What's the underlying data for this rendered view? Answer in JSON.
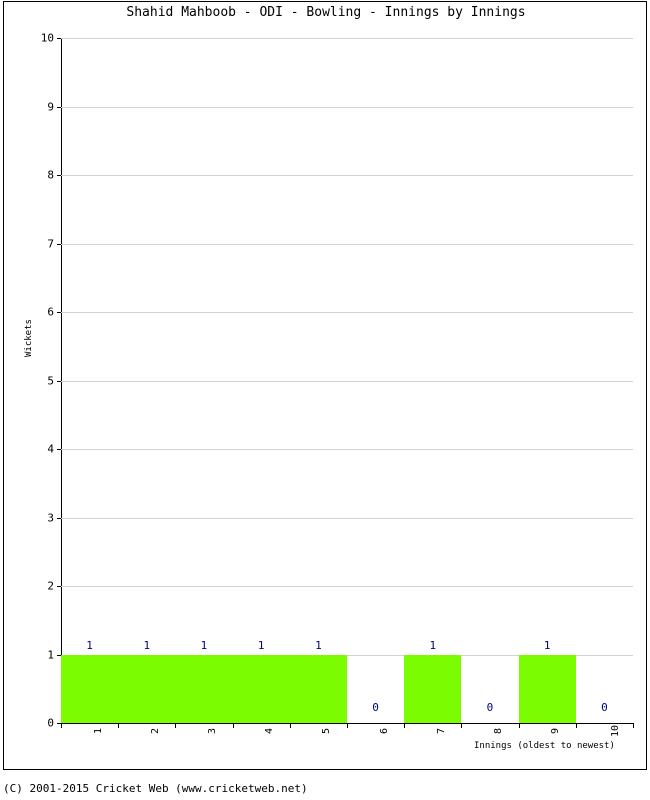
{
  "chart_data": {
    "type": "bar",
    "title": "Shahid Mahboob - ODI - Bowling - Innings by Innings",
    "xlabel": "Innings (oldest to newest)",
    "ylabel": "Wickets",
    "categories": [
      "1",
      "2",
      "3",
      "4",
      "5",
      "6",
      "7",
      "8",
      "9",
      "10"
    ],
    "values": [
      1,
      1,
      1,
      1,
      1,
      0,
      1,
      0,
      1,
      0
    ],
    "value_labels": [
      "1",
      "1",
      "1",
      "1",
      "1",
      "0",
      "1",
      "0",
      "1",
      "0"
    ],
    "ylim": [
      0,
      10
    ],
    "ytick_labels": [
      "0",
      "1",
      "2",
      "3",
      "4",
      "5",
      "6",
      "7",
      "8",
      "9",
      "10"
    ],
    "ytick_values": [
      0,
      1,
      2,
      3,
      4,
      5,
      6,
      7,
      8,
      9,
      10
    ],
    "grid": true,
    "legend": null,
    "bar_color": "#7cfc00",
    "value_label_color": "#000080",
    "gridline_color": "#d2d2d2",
    "axis_color": "#000000"
  },
  "footer": {
    "copyright": "(C) 2001-2015 Cricket Web (www.cricketweb.net)"
  }
}
